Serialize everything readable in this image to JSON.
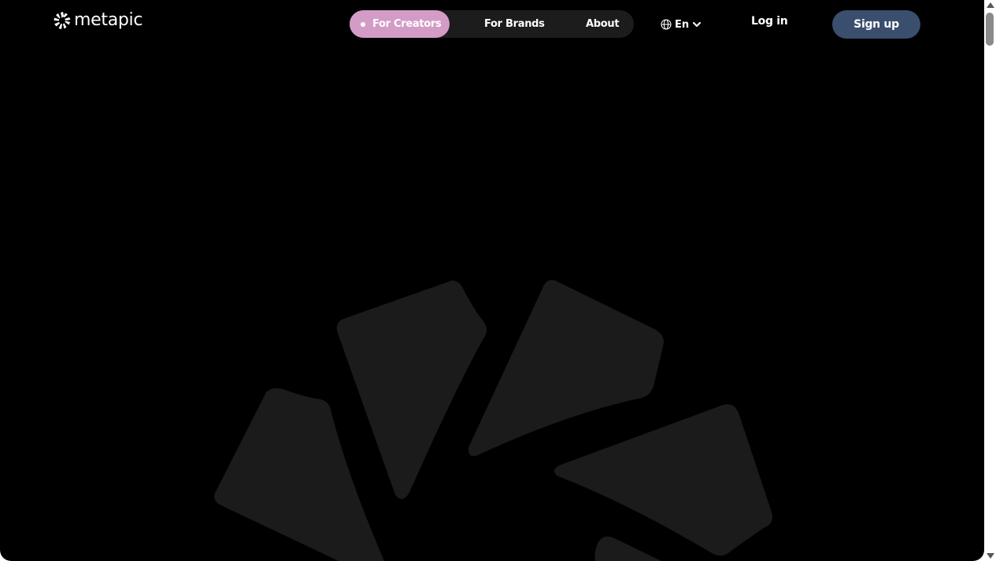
{
  "header": {
    "logo_text": "metapic",
    "nav": {
      "creators_label": "For Creators",
      "brands_label": "For Brands",
      "about_label": "About"
    },
    "language": {
      "icon": "globe-icon",
      "current": "En",
      "dropdown_icon": "chevron-down-icon"
    },
    "login_label": "Log in",
    "signup_label": "Sign up"
  },
  "colors": {
    "background": "#000000",
    "nav_pill": "#1c1c1c",
    "active_tab": "#d39cc7",
    "signup_button": "#3a4e6e",
    "hero_shapes": "#1b1b1b"
  }
}
